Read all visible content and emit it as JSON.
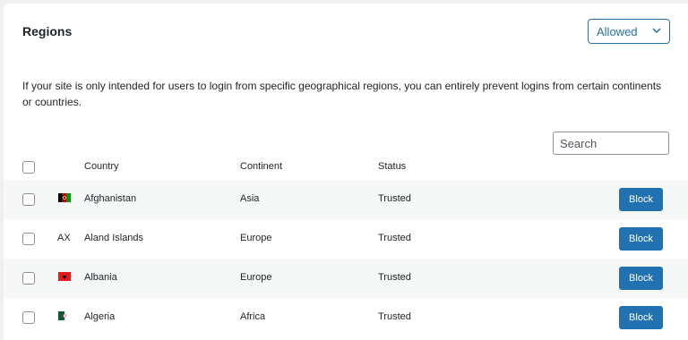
{
  "panel": {
    "title": "Regions",
    "filter_select": {
      "value": "Allowed",
      "icon": "chevron-down-icon"
    },
    "description": "If your site is only intended for users to login from specific geographical regions, you can entirely prevent logins from certain continents or countries.",
    "search": {
      "placeholder": "Search",
      "value": ""
    }
  },
  "table": {
    "columns": {
      "country": "Country",
      "continent": "Continent",
      "status": "Status"
    },
    "rows": [
      {
        "flag": "afghanistan-flag-icon",
        "code": "",
        "country": "Afghanistan",
        "continent": "Asia",
        "status": "Trusted",
        "action": "Block"
      },
      {
        "flag": "",
        "code": "AX",
        "country": "Aland Islands",
        "continent": "Europe",
        "status": "Trusted",
        "action": "Block"
      },
      {
        "flag": "albania-flag-icon",
        "code": "",
        "country": "Albania",
        "continent": "Europe",
        "status": "Trusted",
        "action": "Block"
      },
      {
        "flag": "algeria-flag-icon",
        "code": "",
        "country": "Algeria",
        "continent": "Africa",
        "status": "Trusted",
        "action": "Block"
      }
    ]
  },
  "colors": {
    "accent": "#2271b1",
    "row_alt": "#f6f7f7",
    "page_bg": "#f0f0f1"
  }
}
